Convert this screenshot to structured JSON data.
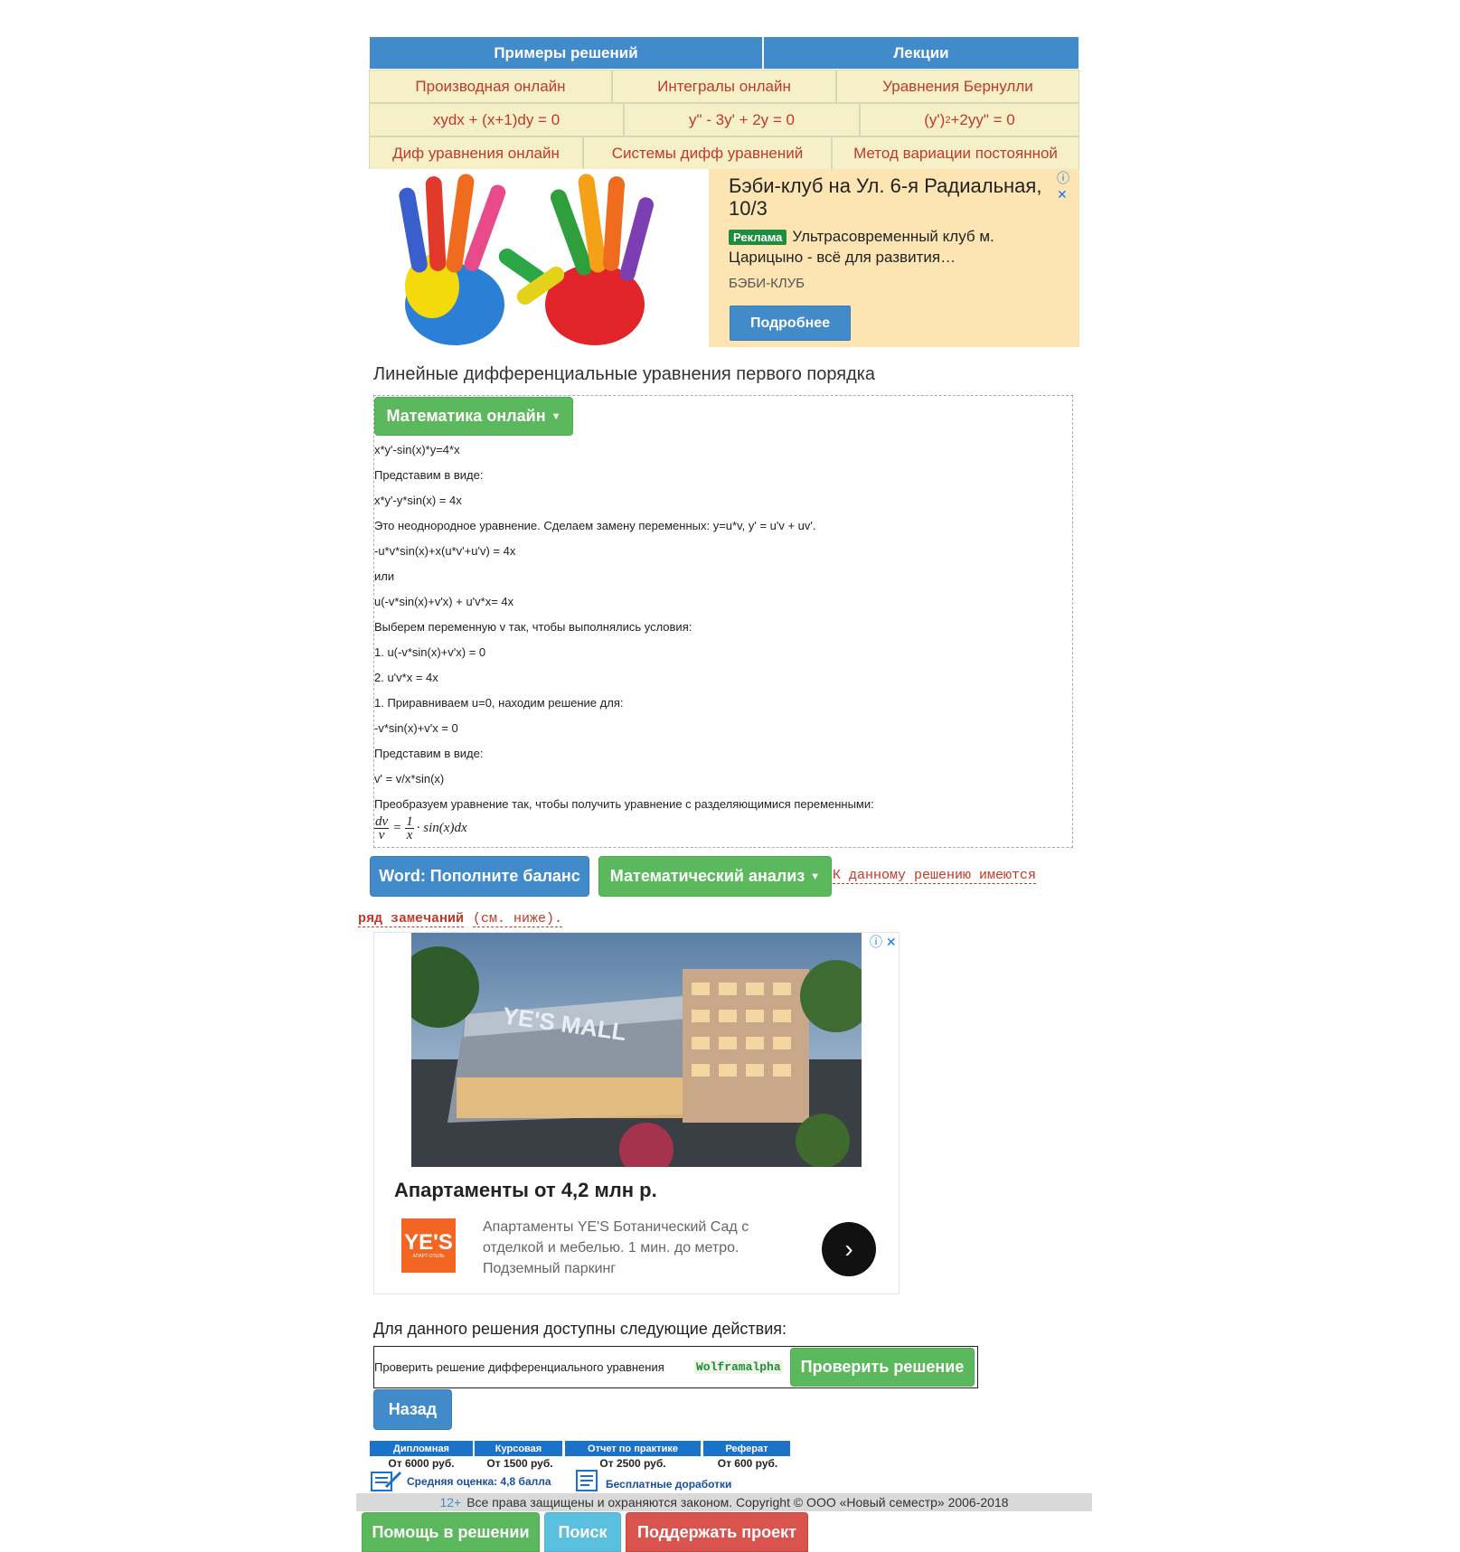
{
  "top_tabs": [
    "Примеры решений",
    "Лекции"
  ],
  "nav_row1": [
    "Производная онлайн",
    "Интегралы онлайн",
    "Уравнения Бернулли"
  ],
  "nav_row2": {
    "a": "xydx + (x+1)dy = 0",
    "b": "y\" - 3y' + 2y = 0",
    "c_pre": "(y')",
    "c_sup": "2",
    "c_post": "+2yy\" = 0"
  },
  "nav_row3": [
    "Диф уравнения онлайн",
    "Системы дифф уравнений",
    "Метод вариации постоянной"
  ],
  "ad1": {
    "title": "Бэби-клуб на Ул. 6-я Радиальная, 10/3",
    "badge": "Реклама",
    "text": "Ультрасовременный клуб м. Царицыно - всё для развития…",
    "brand": "БЭБИ-КЛУБ",
    "button": "Подробнее"
  },
  "page_title": "Линейные дифференциальные уравнения первого порядка",
  "math_online_btn": "Математика онлайн",
  "solution_lines": [
    "x*y'-sin(x)*y=4*x",
    "Представим в виде:",
    "x*y'-y*sin(x) = 4x",
    "Это неоднородное уравнение. Сделаем замену переменных: y=u*v, y' = u'v + uv'.",
    "-u*v*sin(x)+x(u*v'+u'v) = 4x",
    "или",
    "u(-v*sin(x)+v'x) + u'v*x= 4x",
    "Выберем переменную v так, чтобы выполнялись условия:",
    "1. u(-v*sin(x)+v'x) = 0",
    "2. u'v*x = 4x",
    "1. Приравниваем u=0, находим решение для:",
    "-v*sin(x)+v'x = 0",
    "Представим в виде:",
    "v' = v/x*sin(x)",
    "Преобразуем уравнение так, чтобы получить уравнение с разделяющимися переменными:"
  ],
  "formula": {
    "num1": "dv",
    "den1": "v",
    "eq": "=",
    "num2": "1",
    "den2": "x",
    "rest": "· sin(x)dx"
  },
  "word_btn": "Word: Пополните баланс",
  "analysis_btn": "Математический анализ",
  "remark": {
    "part1": "К данному решению имеются",
    "bold": "ряд замечаний",
    "part2": "(см. ниже)."
  },
  "ad2": {
    "title": "Апартаменты от 4,2 млн р.",
    "text": "Апартаменты YE'S Ботанический Сад с отделкой и мебелью. 1 мин. до метро. Подземный паркинг",
    "logo": "YE'S",
    "logo_sub": "АПАРТ-ОТЕЛЬ",
    "mall_sign": "YE'S MALL"
  },
  "actions_title": "Для данного решения доступны следующие действия:",
  "check_text": "Проверить решение дифференциального уравнения",
  "wolfram": "Wolframalpha",
  "check_btn": "Проверить решение",
  "back_btn": "Назад",
  "prices": [
    {
      "name": "Дипломная",
      "price": "От 6000 руб."
    },
    {
      "name": "Курсовая",
      "price": "От 1500 руб."
    },
    {
      "name": "Отчет по практике",
      "price": "От 2500 руб."
    },
    {
      "name": "Реферат",
      "price": "От 600 руб."
    }
  ],
  "rating": "Средняя оценка: 4,8 балла",
  "free_fixes": "Бесплатные доработки",
  "footer": {
    "age": "12+",
    "text": "Все права защищены и охраняются законом. Copyright © ООО «Новый семестр» 2006-2018"
  },
  "bottom_buttons": [
    "Помощь в решении",
    "Поиск",
    "Поддержать проект"
  ],
  "colors": {
    "blue": "#428bca",
    "green": "#5cb85c",
    "red": "#d9534f",
    "teal": "#5bc0de",
    "nav_bg": "#f6f0c8",
    "ad_bg": "#fde5b3"
  }
}
